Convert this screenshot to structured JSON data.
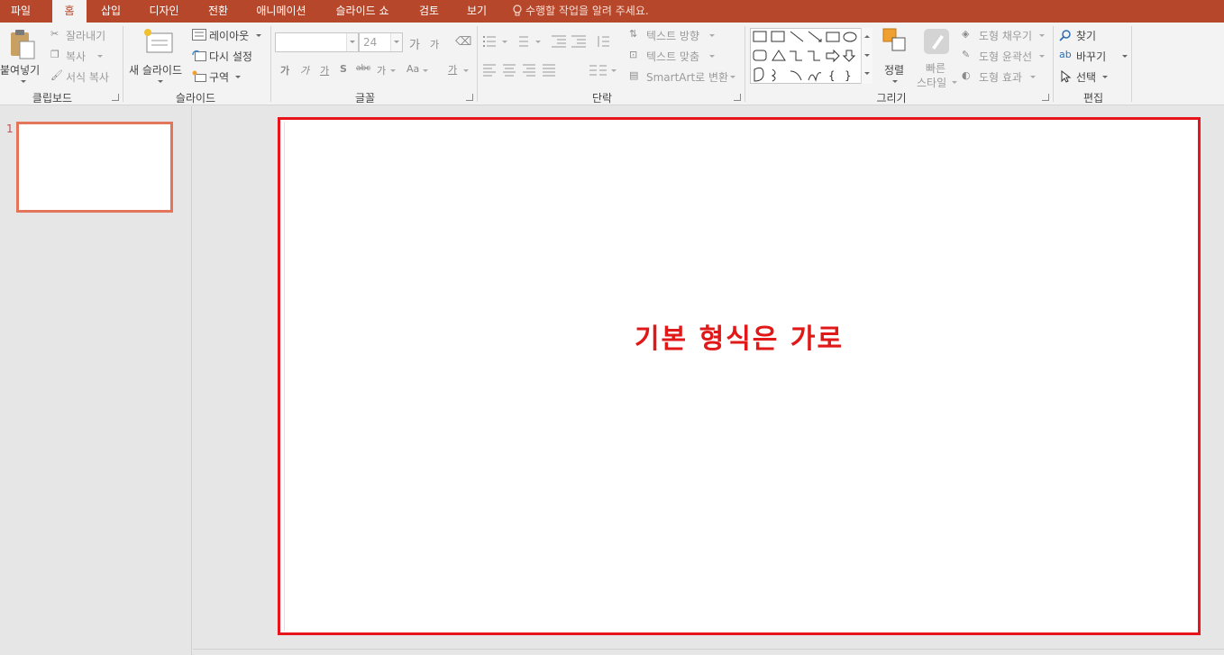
{
  "tabs": [
    "파일",
    "홈",
    "삽입",
    "디자인",
    "전환",
    "애니메이션",
    "슬라이드 쇼",
    "검토",
    "보기"
  ],
  "tell_me": "수행할 작업을 알려 주세요.",
  "clipboard": {
    "paste": "붙여넣기",
    "cut": "잘라내기",
    "copy": "복사",
    "format_painter": "서식 복사",
    "group_label": "클립보드"
  },
  "slides_group": {
    "new_slide": "새 슬라이드",
    "layout": "레이아웃",
    "reset": "다시 설정",
    "section": "구역",
    "group_label": "슬라이드"
  },
  "font": {
    "font_name": "",
    "font_size": "24",
    "group_label": "글꼴",
    "grow_glyph": "가",
    "shrink_glyph": "가",
    "bold_glyph": "가",
    "italic_glyph": "가",
    "underline_glyph": "가",
    "shadow_glyph": "S",
    "strike_glyph": "abc",
    "spacing_glyph": "가",
    "case_glyph": "Aa",
    "color_glyph": "가"
  },
  "paragraph": {
    "text_direction": "텍스트 방향",
    "align_text": "텍스트 맞춤",
    "smartart": "SmartArt로 변환",
    "group_label": "단락"
  },
  "drawing": {
    "arrange": "정렬",
    "quick_styles_1": "빠른",
    "quick_styles_2": "스타일",
    "shape_fill": "도형 채우기",
    "shape_outline": "도형 윤곽선",
    "shape_effects": "도형 효과",
    "group_label": "그리기"
  },
  "editing": {
    "find": "찾기",
    "replace": "바꾸기",
    "select": "선택",
    "group_label": "편집"
  },
  "thumbnail": {
    "number": "1"
  },
  "slide": {
    "text": "기본 형식은 가로"
  },
  "colors": {
    "accent": "#b7472a",
    "slide_text": "#e01818",
    "highlight_border": "#e8141b"
  }
}
